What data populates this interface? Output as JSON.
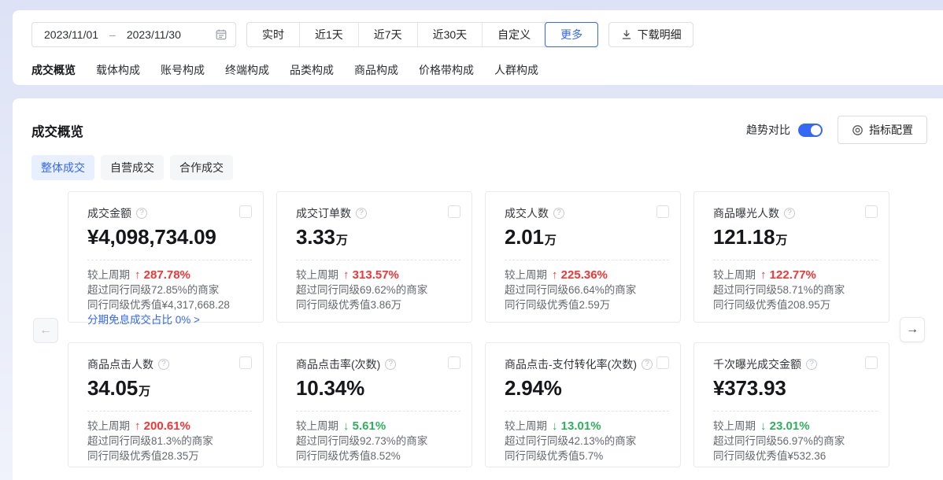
{
  "colors": {
    "accent_blue": "#3468f5",
    "up_red": "#f23535",
    "down_green": "#2eb05c"
  },
  "icons": {
    "help": "?",
    "left_arrow": "←",
    "right_arrow": "→"
  },
  "filter_bar": {
    "date_start": "2023/11/01",
    "date_separator": "–",
    "date_end": "2023/11/30",
    "quick_ranges": [
      {
        "label": "实时",
        "active": false
      },
      {
        "label": "近1天",
        "active": false
      },
      {
        "label": "近7天",
        "active": false
      },
      {
        "label": "近30天",
        "active": false
      },
      {
        "label": "自定义",
        "active": false
      },
      {
        "label": "更多",
        "active": true
      }
    ],
    "download_label": "下载明细",
    "tabs": [
      {
        "label": "成交概览",
        "active": true
      },
      {
        "label": "载体构成",
        "active": false
      },
      {
        "label": "账号构成",
        "active": false
      },
      {
        "label": "终端构成",
        "active": false
      },
      {
        "label": "品类构成",
        "active": false
      },
      {
        "label": "商品构成",
        "active": false
      },
      {
        "label": "价格带构成",
        "active": false
      },
      {
        "label": "人群构成",
        "active": false
      }
    ]
  },
  "panel": {
    "title": "成交概览",
    "trend_compare_label": "趋势对比",
    "trend_compare_on": true,
    "config_button_label": "指标配置",
    "subtabs": [
      {
        "label": "整体成交",
        "active": true
      },
      {
        "label": "自营成交",
        "active": false
      },
      {
        "label": "合作成交",
        "active": false
      }
    ],
    "cards": [
      {
        "title": "成交金额",
        "value": "¥4,098,734.09",
        "unit": "",
        "compare_label": "较上周期",
        "change": "↑ 287.78%",
        "direction": "up",
        "peer_line": "超过同行同级72.85%的商家",
        "excellent_line": "同行同级优秀值¥4,317,668.28",
        "link": "分期免息成交占比 0% >"
      },
      {
        "title": "成交订单数",
        "value": "3.33",
        "unit": "万",
        "compare_label": "较上周期",
        "change": "↑ 313.57%",
        "direction": "up",
        "peer_line": "超过同行同级69.62%的商家",
        "excellent_line": "同行同级优秀值3.86万"
      },
      {
        "title": "成交人数",
        "value": "2.01",
        "unit": "万",
        "compare_label": "较上周期",
        "change": "↑ 225.36%",
        "direction": "up",
        "peer_line": "超过同行同级66.64%的商家",
        "excellent_line": "同行同级优秀值2.59万"
      },
      {
        "title": "商品曝光人数",
        "value": "121.18",
        "unit": "万",
        "compare_label": "较上周期",
        "change": "↑ 122.77%",
        "direction": "up",
        "peer_line": "超过同行同级58.71%的商家",
        "excellent_line": "同行同级优秀值208.95万"
      },
      {
        "title": "商品点击人数",
        "value": "34.05",
        "unit": "万",
        "compare_label": "较上周期",
        "change": "↑ 200.61%",
        "direction": "up",
        "peer_line": "超过同行同级81.3%的商家",
        "excellent_line": "同行同级优秀值28.35万"
      },
      {
        "title": "商品点击率(次数)",
        "value": "10.34%",
        "unit": "",
        "compare_label": "较上周期",
        "change": "↓ 5.61%",
        "direction": "down",
        "peer_line": "超过同行同级92.73%的商家",
        "excellent_line": "同行同级优秀值8.52%"
      },
      {
        "title": "商品点击-支付转化率(次数)",
        "value": "2.94%",
        "unit": "",
        "compare_label": "较上周期",
        "change": "↓ 13.01%",
        "direction": "down",
        "peer_line": "超过同行同级42.13%的商家",
        "excellent_line": "同行同级优秀值5.7%"
      },
      {
        "title": "千次曝光成交金额",
        "value": "¥373.93",
        "unit": "",
        "compare_label": "较上周期",
        "change": "↓ 23.01%",
        "direction": "down",
        "peer_line": "超过同行同级56.97%的商家",
        "excellent_line": "同行同级优秀值¥532.36"
      }
    ]
  }
}
